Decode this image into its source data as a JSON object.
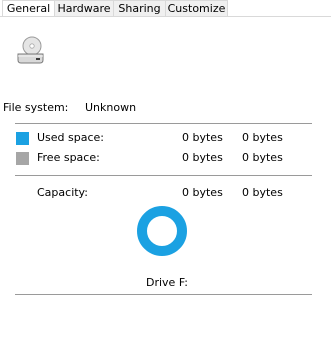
{
  "tabs": [
    {
      "label": "General",
      "active": true
    },
    {
      "label": "Hardware",
      "active": false
    },
    {
      "label": "Sharing",
      "active": false
    },
    {
      "label": "Customize",
      "active": false
    }
  ],
  "file_system": {
    "label": "File system:",
    "value": "Unknown"
  },
  "used_space": {
    "label": "Used space:",
    "bytes": "0 bytes",
    "size": "0 bytes",
    "color": "#1ba1e2"
  },
  "free_space": {
    "label": "Free space:",
    "bytes": "0 bytes",
    "size": "0 bytes",
    "color": "#a6a6a6"
  },
  "capacity": {
    "label": "Capacity:",
    "bytes": "0 bytes",
    "size": "0 bytes"
  },
  "drive": {
    "label": "Drive F:",
    "icon": "drive-icon",
    "ring_color": "#1ba1e2"
  }
}
